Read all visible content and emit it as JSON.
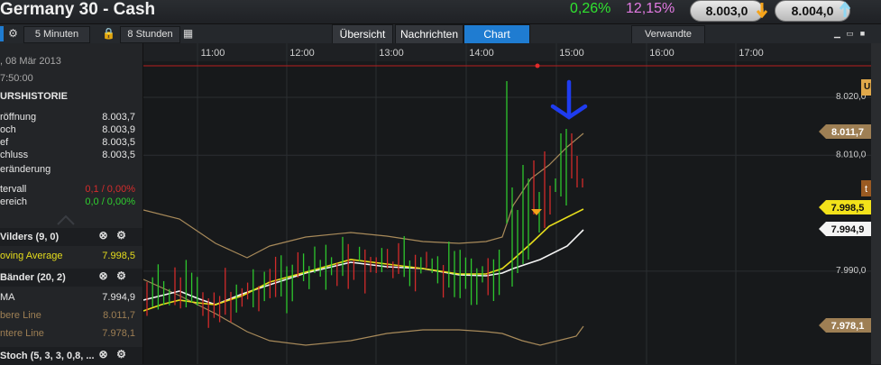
{
  "header": {
    "title": "Germany 30 - Cash",
    "change_abs": "0,26%",
    "change_pct": "12,15%",
    "sell_price": "8.003,0",
    "buy_price": "8.004,0",
    "colors": {
      "up": "#2fe52f",
      "pct": "#e27ae2",
      "accent": "#1f7cd1"
    }
  },
  "toolbar": {
    "interval": "5 Minuten",
    "range": "8 Stunden",
    "tabs": [
      "Übersicht",
      "Nachrichten",
      "Chart"
    ],
    "active_tab": "Chart",
    "related": "Verwandte",
    "icons": [
      "gear-icon",
      "lock-icon",
      "calendar-icon",
      "minimize-icon",
      "restore-icon",
      "maximize-icon"
    ]
  },
  "sidebar": {
    "date": ", 08 Mär 2013",
    "time": "7:50:00",
    "history_title": "URSHISTORIE",
    "ohlc": [
      {
        "label": "röffnung",
        "value": "8.003,7"
      },
      {
        "label": "och",
        "value": "8.003,9"
      },
      {
        "label": "ef",
        "value": "8.003,5"
      },
      {
        "label": "chluss",
        "value": "8.003,5"
      }
    ],
    "change_label": "eränderung",
    "interval_label": "tervall",
    "interval_value": "0,1 / 0,00%",
    "range_label": "ereich",
    "range_value": "0,0 / 0,00%",
    "wilders_title": "Vilders (9, 0)",
    "moving_avg_label": "oving Average",
    "moving_avg_value": "7.998,5",
    "bands_title": "Bänder (20, 2)",
    "ma_label": "MA",
    "ma_value": "7.994,9",
    "upper_label": "bere Line",
    "upper_value": "8.011,7",
    "lower_label": "ntere Line",
    "lower_value": "7.978,1",
    "stoch_title": "Stoch (5, 3, 3, 0,8, ..."
  },
  "chart_data": {
    "type": "candlestick",
    "x_ticks": [
      "11:00",
      "12:00",
      "13:00",
      "14:00",
      "15:00",
      "16:00",
      "17:00"
    ],
    "y_ticks": [
      "8.020,0",
      "8.010,0",
      "7.990,0"
    ],
    "ylim": [
      7975,
      8026
    ],
    "price_tags": [
      {
        "label": "8.011,7",
        "value": 8011.7,
        "color": "#9e7f54"
      },
      {
        "label": "7.998,5",
        "value": 7998.5,
        "color": "#f2e21a"
      },
      {
        "label": "7.994,9",
        "value": 7994.9,
        "color": "#f4f4f4"
      },
      {
        "label": "7.978,1",
        "value": 7978.1,
        "color": "#9e7f54"
      }
    ],
    "side_labels": [
      "UF",
      "t"
    ],
    "colors": {
      "up": "#2dc62d",
      "down": "#d22a2a",
      "upper": "#a88a5a",
      "ma_yellow": "#e6dd1c",
      "ma_white": "#f4f4f4",
      "annotation": "#1f3cf0",
      "hline": "#b81f1f"
    }
  }
}
